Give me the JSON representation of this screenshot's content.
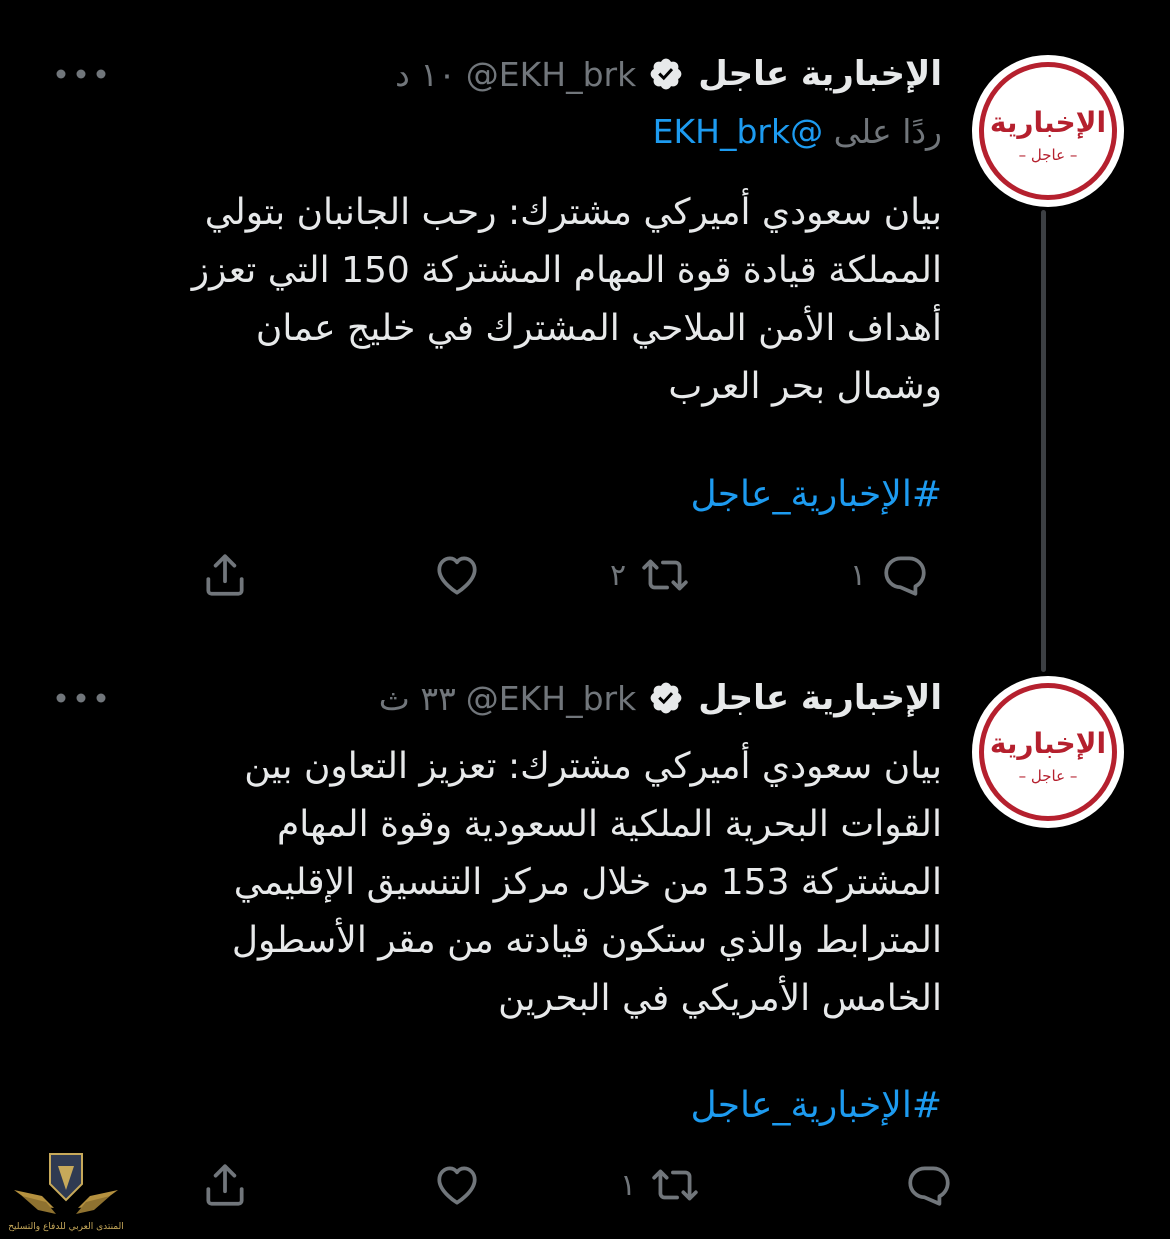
{
  "tweets": [
    {
      "avatar": {
        "word": "الإخبارية",
        "sub": "– عاجل –"
      },
      "display_name": "الإخبارية عاجل",
      "handle": "@EKH_brk",
      "timestamp": "١٠ د",
      "reply_prefix": "ردًا على",
      "reply_handle": "@EKH_brk",
      "text": "بيان سعودي أميركي مشترك: رحب الجانبان بتولي\nالمملكة قيادة قوة المهام المشتركة 150 التي تعزز\nأهداف الأمن الملاحي المشترك في خليج عمان\nوشمال بحر العرب",
      "hashtag": "#الإخبارية_عاجل",
      "actions": {
        "reply_count": "١",
        "retweet_count": "٢",
        "like_count": "",
        "share": ""
      }
    },
    {
      "avatar": {
        "word": "الإخبارية",
        "sub": "– عاجل –"
      },
      "display_name": "الإخبارية عاجل",
      "handle": "@EKH_brk",
      "timestamp": "٣٣ ث",
      "text": "بيان سعودي أميركي مشترك: تعزيز التعاون بين\nالقوات البحرية الملكية السعودية وقوة المهام\nالمشتركة 153 من خلال مركز التنسيق الإقليمي\nالمترابط والذي ستكون قيادته من مقر الأسطول\nالخامس الأمريكي في البحرين",
      "hashtag": "#الإخبارية_عاجل",
      "actions": {
        "reply_count": "",
        "retweet_count": "١",
        "like_count": "",
        "share": ""
      }
    }
  ],
  "watermark": {
    "text": "المنتدى العربي للدفاع والتسليح"
  },
  "colors": {
    "background": "#000000",
    "text": "#e7e9ea",
    "muted": "#71767b",
    "link": "#1d9bf0",
    "brand_red": "#b5202e",
    "thread_line": "#3c3f43"
  },
  "icons": [
    "reply-icon",
    "retweet-icon",
    "like-icon",
    "share-icon",
    "verified-icon",
    "more-icon"
  ]
}
